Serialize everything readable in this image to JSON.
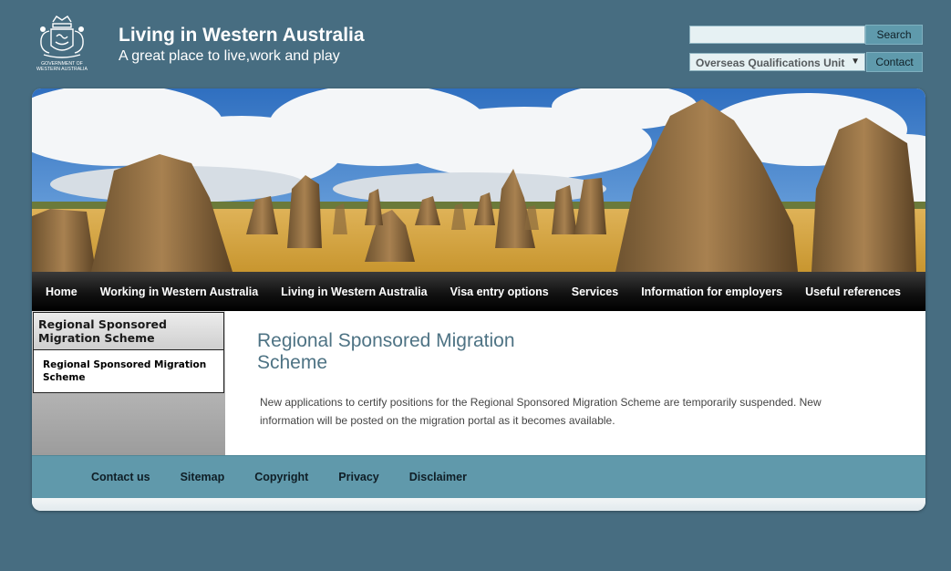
{
  "header": {
    "crest_caption": "GOVERNMENT OF WESTERN AUSTRALIA",
    "title": "Living in Western Australia",
    "tagline": "A great place to live,work and play"
  },
  "search": {
    "value": "",
    "placeholder": "",
    "button_label": "Search"
  },
  "unit_select": {
    "selected": "Overseas Qualifications Unit",
    "arrow": "▼"
  },
  "contact_button": "Contact",
  "nav": {
    "items": [
      {
        "label": "Home"
      },
      {
        "label": "Working in Western Australia"
      },
      {
        "label": "Living in Western Australia"
      },
      {
        "label": "Visa entry options"
      },
      {
        "label": "Services"
      },
      {
        "label": "Information for employers"
      },
      {
        "label": "Useful references"
      }
    ]
  },
  "sidebar": {
    "heading": "Regional Sponsored Migration Scheme",
    "links": [
      {
        "label": "Regional Sponsored Migration Scheme"
      }
    ]
  },
  "main": {
    "title": "Regional Sponsored Migration Scheme",
    "body": "New applications to certify positions for the Regional Sponsored Migration Scheme are temporarily suspended.  New information will be posted on the migration portal as it becomes available."
  },
  "footer": {
    "links": [
      {
        "label": "Contact us"
      },
      {
        "label": "Sitemap"
      },
      {
        "label": "Copyright"
      },
      {
        "label": "Privacy"
      },
      {
        "label": "Disclaimer"
      }
    ]
  },
  "colors": {
    "page_background": "#476d81",
    "accent_teal": "#6099ab",
    "title_blue": "#4e7384",
    "nav_background": "#000000"
  },
  "icons": {
    "crest": "wa-government-crest-icon",
    "dropdown": "chevron-down-icon"
  }
}
